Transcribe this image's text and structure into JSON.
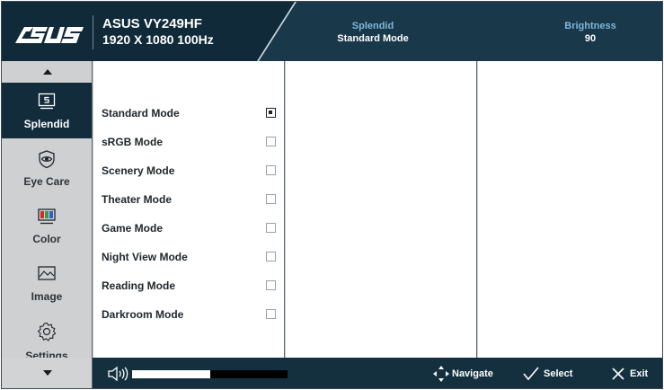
{
  "header": {
    "brand": "ASUS",
    "model": "ASUS VY249HF",
    "resolution": "1920 X 1080 100Hz",
    "status": [
      {
        "key": "Splendid",
        "value": "Standard Mode"
      },
      {
        "key": "Brightness",
        "value": "90"
      }
    ]
  },
  "sidebar": {
    "items": [
      {
        "label": "Splendid",
        "icon": "splendid-icon",
        "active": true
      },
      {
        "label": "Eye Care",
        "icon": "eye-care-icon",
        "active": false
      },
      {
        "label": "Color",
        "icon": "color-icon",
        "active": false
      },
      {
        "label": "Image",
        "icon": "image-icon",
        "active": false
      },
      {
        "label": "Settings",
        "icon": "settings-icon",
        "active": false
      }
    ]
  },
  "splendid_modes": [
    {
      "label": "Standard Mode",
      "selected": true
    },
    {
      "label": "sRGB Mode",
      "selected": false
    },
    {
      "label": "Scenery Mode",
      "selected": false
    },
    {
      "label": "Theater Mode",
      "selected": false
    },
    {
      "label": "Game Mode",
      "selected": false
    },
    {
      "label": "Night View Mode",
      "selected": false
    },
    {
      "label": "Reading Mode",
      "selected": false
    },
    {
      "label": "Darkroom Mode",
      "selected": false
    }
  ],
  "footer": {
    "volume_fraction": 0.5,
    "navigate_label": "Navigate",
    "select_label": "Select",
    "exit_label": "Exit"
  },
  "colors": {
    "header_dark": "#102a39",
    "header_accent": "#7fb7d9",
    "active_item": "#122c3b"
  }
}
